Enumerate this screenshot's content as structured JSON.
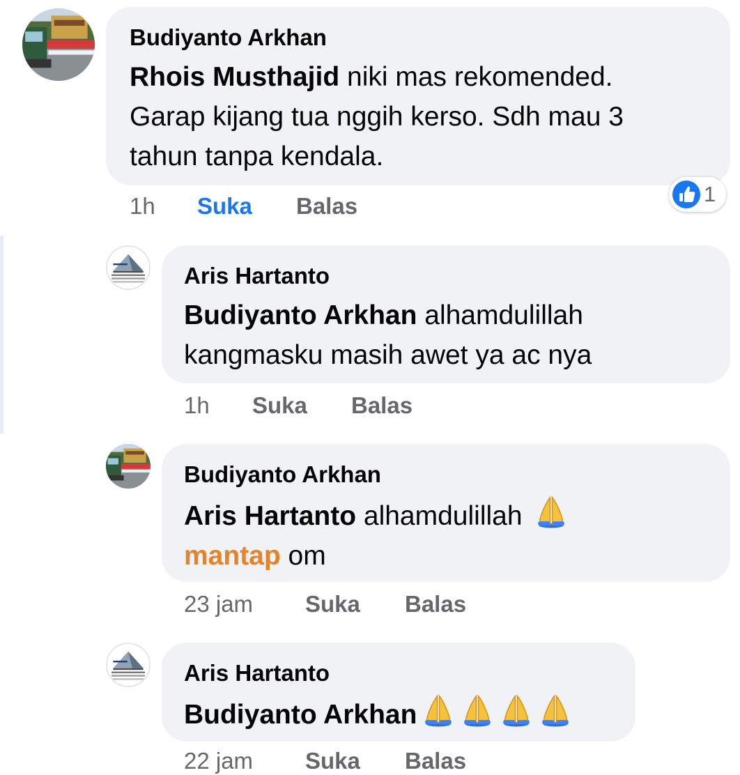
{
  "comments": [
    {
      "author": "Budiyanto Arkhan",
      "mention": "Rhois Musthajid",
      "text_line1": " niki mas rekomended.",
      "text_line2": "Garap kijang tua nggih kerso. Sdh mau 3",
      "text_line3": "tahun tanpa kendala.",
      "time": "1h",
      "like_label": "Suka",
      "reply_label": "Balas",
      "liked": true,
      "reaction_count": "1",
      "avatar_icon": "photo-avatar"
    },
    {
      "author": "Aris Hartanto",
      "mention": "Budiyanto Arkhan",
      "text_line1": " alhamdulillah",
      "text_line2": "kangmasku masih awet ya ac nya",
      "time": "1h",
      "like_label": "Suka",
      "reply_label": "Balas",
      "avatar_icon": "logo-avatar"
    },
    {
      "author": "Budiyanto Arkhan",
      "mention": "Aris Hartanto",
      "text_line1": " alhamdulillah ",
      "hashtag": "mantap",
      "text_line2": " om",
      "emoji": "folded-hands-icon",
      "time": "23 jam",
      "like_label": "Suka",
      "reply_label": "Balas",
      "avatar_icon": "photo-avatar"
    },
    {
      "author": "Aris Hartanto",
      "mention": "Budiyanto Arkhan",
      "emoji": "folded-hands-icon",
      "emoji_count": 4,
      "time": "22 jam",
      "like_label": "Suka",
      "reply_label": "Balas",
      "avatar_icon": "logo-avatar"
    }
  ],
  "colors": {
    "bubble": "#f0f2f5",
    "meta": "#65676b",
    "liked": "#1877f2",
    "hashtag": "#e4832a"
  }
}
